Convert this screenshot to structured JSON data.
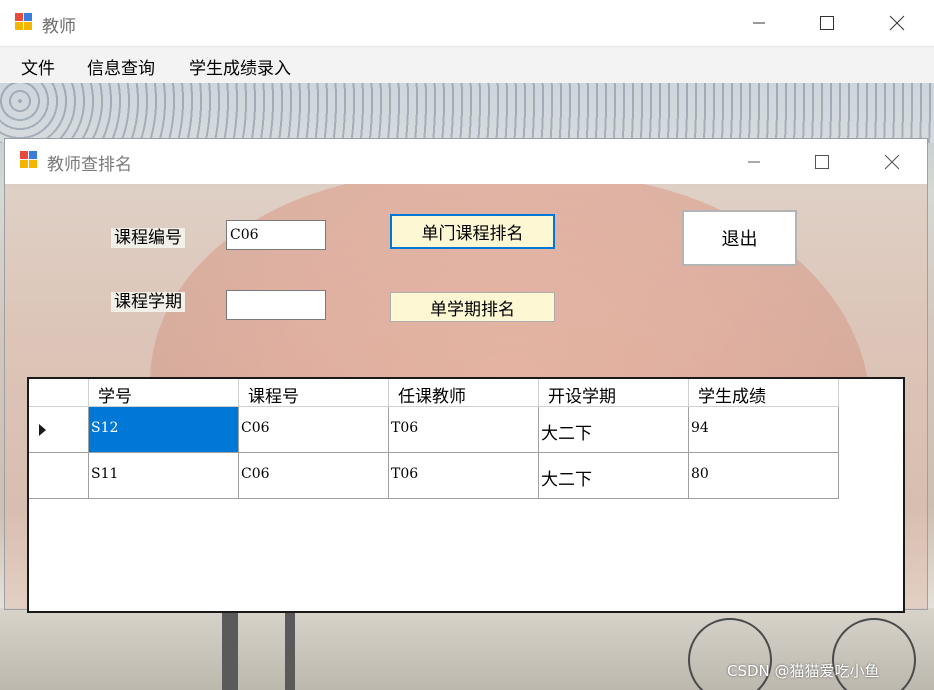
{
  "window": {
    "title": "教师",
    "icon": "winforms-app-icon",
    "controls": [
      "minimize-icon",
      "maximize-icon",
      "close-icon"
    ]
  },
  "menu": {
    "items": [
      "文件",
      "信息查询",
      "学生成绩录入"
    ]
  },
  "dialog": {
    "title": "教师查排名",
    "course_id_label": "课程编号",
    "course_id_value": "C06",
    "semester_label": "课程学期",
    "semester_value": "",
    "single_course_rank_button": "单门课程排名",
    "single_semester_rank_button": "单学期排名",
    "exit_button": "退出"
  },
  "grid": {
    "columns": [
      "学号",
      "课程号",
      "任课教师",
      "开设学期",
      "学生成绩"
    ],
    "rows": [
      [
        "S12",
        "C06",
        "T06",
        "大二下",
        "94"
      ],
      [
        "S11",
        "C06",
        "T06",
        "大二下",
        "80"
      ]
    ],
    "current_row": 0,
    "selected_cell": [
      0,
      0
    ]
  },
  "watermark": "CSDN @猫猫爱吃小鱼",
  "colors": {
    "selection": "#0078d7",
    "button_fill": "#fdf8d3",
    "focus_border": "#0078d7"
  }
}
